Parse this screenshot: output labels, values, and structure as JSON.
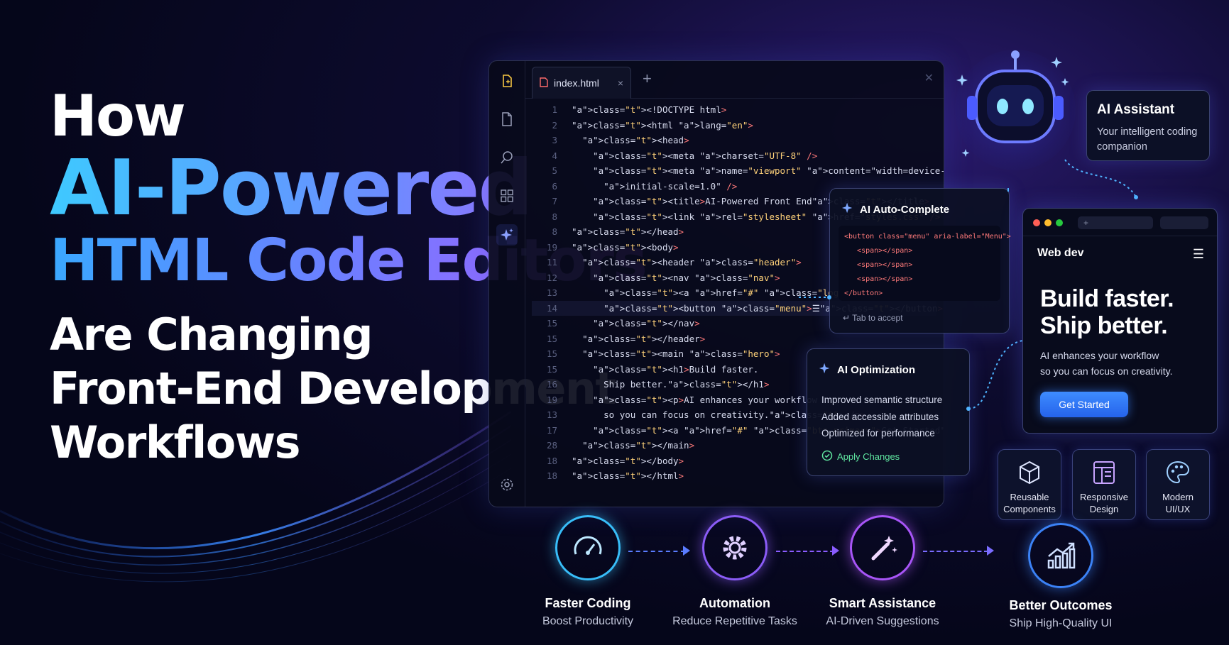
{
  "headline": {
    "line1": "How",
    "line2": "AI-Powered",
    "line3": "HTML Code Editors",
    "line4": "Are Changing",
    "line5": "Front-End Development",
    "line6": "Workflows"
  },
  "editor": {
    "tab_label": "index.html",
    "tab_close": "×",
    "new_tab": "+",
    "rail_icons": [
      "file-plus-icon",
      "file-icon",
      "search-icon",
      "extensions-icon",
      "sparkle-icon",
      "gear-icon"
    ],
    "code_lines": [
      {
        "n": "1",
        "text": "<!DOCTYPE html>"
      },
      {
        "n": "2",
        "text": "<html lang=\"en\">"
      },
      {
        "n": "3",
        "text": "  <head>"
      },
      {
        "n": "4",
        "text": "    <meta charset=\"UTF-8\" />"
      },
      {
        "n": "5",
        "text": "    <meta name=\"viewport\" content=\"width=device-width,"
      },
      {
        "n": "6",
        "text": "      initial-scale=1.0\" />"
      },
      {
        "n": "7",
        "text": "    <title>AI-Powered Front End</title>"
      },
      {
        "n": "8",
        "text": "    <link rel=\"stylesheet\" href=\"styles.css\" />"
      },
      {
        "n": "8",
        "text": "</head>"
      },
      {
        "n": "19",
        "text": "<body>"
      },
      {
        "n": "11",
        "text": "  <header class=\"header\">"
      },
      {
        "n": "12",
        "text": "    <nav class=\"nav\">"
      },
      {
        "n": "13",
        "text": "      <a href=\"#\" class=\"logo\">Web dev</a>"
      },
      {
        "n": "14",
        "text": "      <button class=\"menu\">☰</button>"
      },
      {
        "n": "15",
        "text": "    </nav>"
      },
      {
        "n": "15",
        "text": "  </header>"
      },
      {
        "n": "15",
        "text": "  <main class=\"hero\">"
      },
      {
        "n": "15",
        "text": "    <h1>Build faster."
      },
      {
        "n": "16",
        "text": "      Ship better.</h1>"
      },
      {
        "n": "19",
        "text": "    <p>AI enhances your workflow"
      },
      {
        "n": "13",
        "text": "      so you can focus on creativity.</p>"
      },
      {
        "n": "17",
        "text": "    <a href=\"#\" class=\"btn primary\">Get Started</a"
      },
      {
        "n": "28",
        "text": "  </main>"
      },
      {
        "n": "18",
        "text": "</body>"
      },
      {
        "n": "18",
        "text": "</html>"
      }
    ]
  },
  "autocomplete": {
    "title": "AI Auto-Complete",
    "snippet": [
      "<button class=\"menu\" aria-label=\"Menu\">",
      "   <span></span>",
      "   <span></span>",
      "   <span></span>",
      "</button>"
    ],
    "hint": "↵ Tab to accept"
  },
  "optimization": {
    "title": "AI Optimization",
    "items": [
      "Improved semantic structure",
      "Added accessible attributes",
      "Optimized for performance"
    ],
    "apply": "Apply Changes"
  },
  "assistant": {
    "title": "AI Assistant",
    "subtitle": "Your intelligent coding companion"
  },
  "browser": {
    "url_plus": "+",
    "brand": "Web dev",
    "menu_glyph": "☰",
    "hero_line1": "Build faster.",
    "hero_line2": "Ship better.",
    "para_line1": "AI enhances your workflow",
    "para_line2": "so you can focus on creativity.",
    "cta": "Get Started"
  },
  "tiles": [
    {
      "icon": "cube-icon",
      "line1": "Reusable",
      "line2": "Components"
    },
    {
      "icon": "layout-icon",
      "line1": "Responsive",
      "line2": "Design"
    },
    {
      "icon": "palette-icon",
      "line1": "Modern",
      "line2": "UI/UX"
    }
  ],
  "steps": [
    {
      "icon": "speedometer-icon",
      "title": "Faster Coding",
      "subtitle": "Boost Productivity",
      "color": "#38bdf8"
    },
    {
      "icon": "gear-icon",
      "title": "Automation",
      "subtitle": "Reduce Repetitive Tasks",
      "color": "#8b5cf6"
    },
    {
      "icon": "magic-wand-icon",
      "title": "Smart Assistance",
      "subtitle": "AI-Driven Suggestions",
      "color": "#a855f7"
    },
    {
      "icon": "chart-growth-icon",
      "title": "Better Outcomes",
      "subtitle": "Ship High-Quality UI",
      "color": "#3b82f6"
    }
  ],
  "colors": {
    "accent_blue": "#3aa8ff",
    "accent_purple": "#a95cff",
    "success": "#5fe6a0",
    "cta": "#2563eb"
  }
}
